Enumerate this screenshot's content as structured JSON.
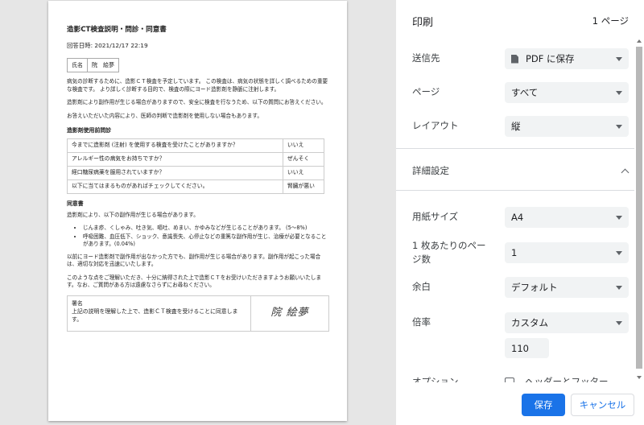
{
  "document": {
    "title": "造影CT検査説明・問診・同意書",
    "datetime": "回答日時: 2021/12/17 22:19",
    "name_label": "氏名",
    "name_value": "院　絵夢",
    "intro1": "病気の診断するために、造影ＣＴ検査を予定しています。 この検査は、病気の状態を詳しく調べるための重要な検査です。 より詳しく診断する目的で、検査の際にヨード造影剤を静脈に注射します。",
    "intro2": "造影剤により副作用が生じる場合がありますので、安全に検査を行なうため、以下の質問にお答えください。",
    "intro3": "お答えいただいた内容により、医師の判断で造影剤を使用しない場合もあります。",
    "questions_head": "造影剤使用前問診",
    "questions": [
      {
        "q": "今までに造影剤 (注射) を使用する検査を受けたことがありますか？",
        "a": "いいえ"
      },
      {
        "q": "アレルギー性の病気をお持ちですか？",
        "a": "ぜんそく"
      },
      {
        "q": "経口糖尿病薬を服用されていますか？",
        "a": "いいえ"
      },
      {
        "q": "以下に当てはまるものがあればチェックしてください。",
        "a": "腎臓が悪い"
      }
    ],
    "consent_head": "同意書",
    "consent_intro": "造影剤により、以下の副作用が生じる場合があります。",
    "risks": [
      "じんま疹、くしゃみ、吐き気、嘔吐、めまい、かゆみなどが生じることがあります。 (5〜8%)",
      "呼吸困難、血圧低下、ショック、意識喪失、心停止などの重篤な副作用が生じ、治療が必要となることがあります。(0.04%)"
    ],
    "consent_p2": "以前にヨード造影剤で副作用が出なかった方でも、副作用が生じる場合があります。副作用が起こった場合は、適切な対応を迅速にいたします。",
    "consent_p3": "このような点をご理解いただき、十分に納得された上で造影ＣＴをお受けいただきますようお願いいたします。なお、ご質問がある方は遠慮なさらずにお尋ねください。",
    "sign_label": "署名",
    "sign_text": "上記の説明を理解した上で、造影ＣＴ検査を受けることに同意します。",
    "signature": "院 絵夢"
  },
  "panel": {
    "title": "印刷",
    "page_count": "1 ページ",
    "settings": {
      "destination_label": "送信先",
      "destination_value": "PDF に保存",
      "pages_label": "ページ",
      "pages_value": "すべて",
      "layout_label": "レイアウト",
      "layout_value": "縦",
      "more_settings_label": "詳細設定",
      "paper_size_label": "用紙サイズ",
      "paper_size_value": "A4",
      "pages_per_sheet_label": "1 枚あたりのページ数",
      "pages_per_sheet_value": "1",
      "margins_label": "余白",
      "margins_value": "デフォルト",
      "scale_label": "倍率",
      "scale_value": "カスタム",
      "scale_percent": "110",
      "options_label": "オプション",
      "header_footer_label": "ヘッダーとフッター"
    },
    "buttons": {
      "save": "保存",
      "cancel": "キャンセル"
    }
  },
  "colors": {
    "primary": "#1a73e8",
    "select_bg": "#f1f3f4"
  }
}
